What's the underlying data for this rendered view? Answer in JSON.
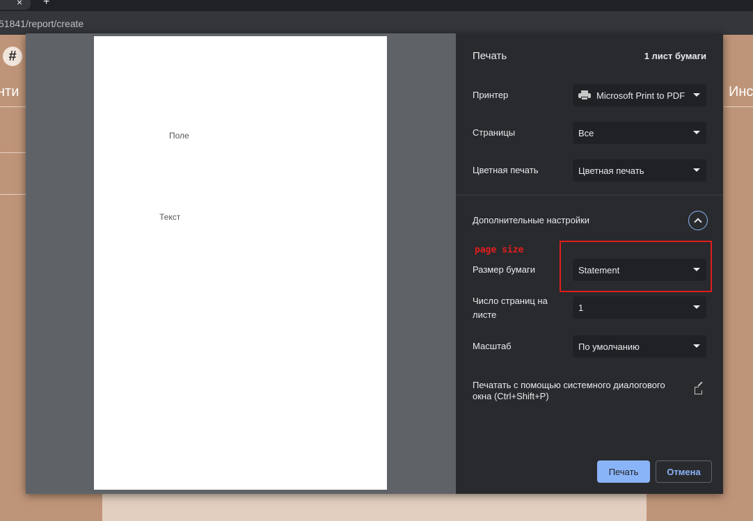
{
  "browser": {
    "tab_close": "×",
    "new_tab": "+",
    "address": "51841/report/create"
  },
  "background_page": {
    "hash_button": "#",
    "left_heading_fragment": "нти",
    "right_heading_fragment": "Инс"
  },
  "preview": {
    "field_text": "Поле",
    "body_text": "Текст"
  },
  "panel": {
    "title": "Печать",
    "sheet_count": "1 лист бумаги",
    "printer": {
      "label": "Принтер",
      "value": "Microsoft Print to PDF",
      "icon": "printer-icon"
    },
    "pages": {
      "label": "Страницы",
      "value": "Все"
    },
    "color": {
      "label": "Цветная печать",
      "value": "Цветная печать"
    },
    "more_settings": {
      "label": "Дополнительные настройки",
      "icon": "chevron-up-icon"
    },
    "annotation": {
      "label": "page size",
      "color": "#e31d1d"
    },
    "paper_size": {
      "label": "Размер бумаги",
      "value": "Statement"
    },
    "pages_per_sheet": {
      "label": "Число страниц на листе",
      "value": "1"
    },
    "scale": {
      "label": "Масштаб",
      "value": "По умолчанию"
    },
    "system_dialog": {
      "label": "Печатать с помощью системного диалогового окна (Ctrl+Shift+P)",
      "icon": "open-external-icon"
    },
    "print_button": "Печать",
    "cancel_button": "Отмена"
  },
  "colors": {
    "panel_bg": "#292a2d",
    "select_bg": "#202124",
    "accent": "#8ab4f8",
    "page_bg": "#bf9579"
  }
}
